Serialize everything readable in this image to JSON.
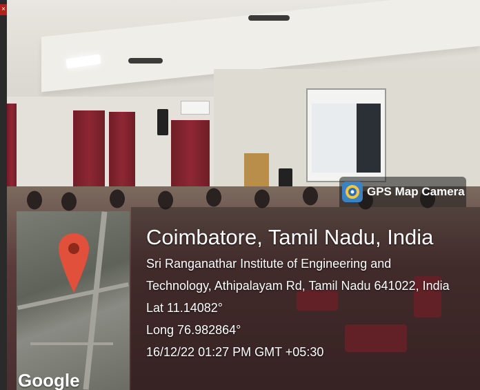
{
  "app": {
    "badge_title": "GPS Map Camera",
    "logo_icon": "gps-map-camera-logo-icon"
  },
  "map": {
    "provider_logo": "Google",
    "pin_color": "#e0503a"
  },
  "location": {
    "city": "Coimbatore, Tamil Nadu, India",
    "address_line1": "Sri Ranganathar Institute of Engineering and",
    "address_line2": "Technology, Athipalayam Rd, Tamil Nadu 641022, India",
    "latitude": "Lat 11.14082°",
    "longitude": "Long 76.982864°",
    "timestamp": "16/12/22 01:27 PM GMT +05:30"
  },
  "window": {
    "close_glyph": "×"
  }
}
